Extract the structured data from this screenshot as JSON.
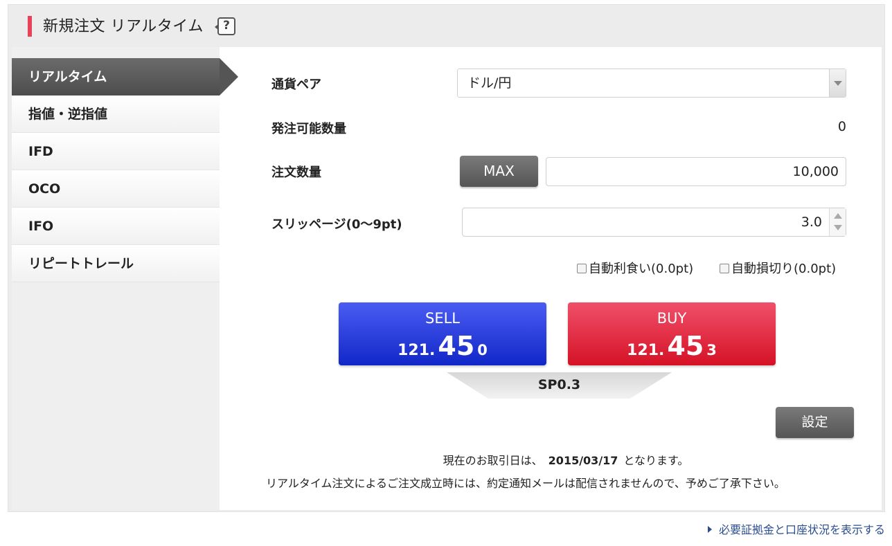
{
  "header": {
    "title": "新規注文 リアルタイム",
    "help_label": "?"
  },
  "sidebar": {
    "items": [
      {
        "label": "リアルタイム",
        "active": true
      },
      {
        "label": "指値・逆指値",
        "active": false
      },
      {
        "label": "IFD",
        "active": false
      },
      {
        "label": "OCO",
        "active": false
      },
      {
        "label": "IFO",
        "active": false
      },
      {
        "label": "リピートトレール",
        "active": false
      }
    ]
  },
  "form": {
    "pair_label": "通貨ペア",
    "pair_value": "ドル/円",
    "available_label": "発注可能数量",
    "available_value": "0",
    "quantity_label": "注文数量",
    "max_label": "MAX",
    "quantity_value": "10,000",
    "slippage_label": "スリッページ(0〜9pt)",
    "slippage_value": "3.0",
    "auto_profit_label": "自動利食い(0.0pt)",
    "auto_loss_label": "自動損切り(0.0pt)"
  },
  "prices": {
    "sell": {
      "side": "SELL",
      "big": "121.",
      "pips": "45",
      "frac": "0"
    },
    "buy": {
      "side": "BUY",
      "big": "121.",
      "pips": "45",
      "frac": "3"
    },
    "spread": "SP0.3"
  },
  "actions": {
    "settings_label": "設定"
  },
  "notes": {
    "trade_date_prefix": "現在のお取引日は、",
    "trade_date": "2015/03/17",
    "trade_date_suffix": "となります。",
    "notice": "リアルタイム注文によるご注文成立時には、約定通知メールは配信されませんので、予めご了承下さい。"
  },
  "footer": {
    "link_label": "必要証拠金と口座状況を表示する"
  },
  "colors": {
    "accent": "#e8425a",
    "sell": "#1a2fd6",
    "buy": "#d91a30",
    "link": "#2a4d8f"
  }
}
